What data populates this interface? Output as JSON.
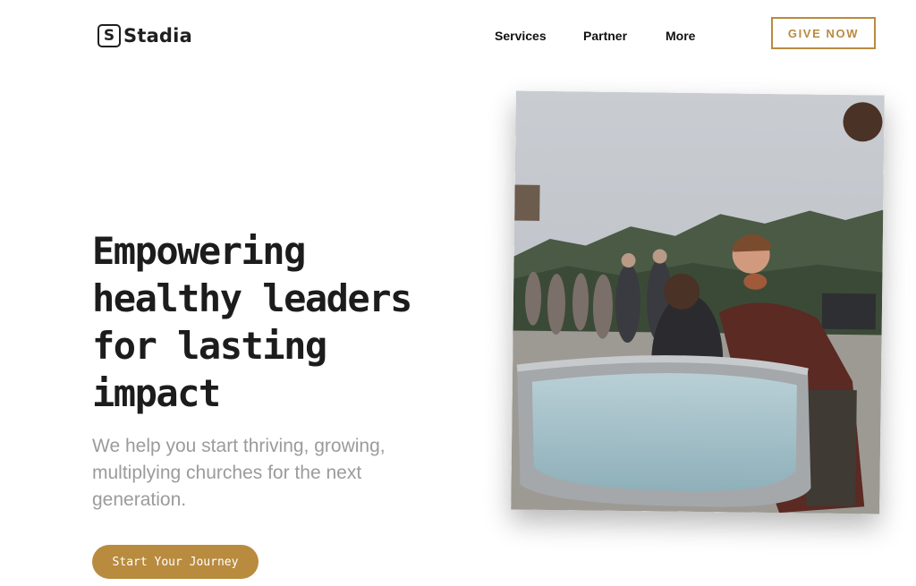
{
  "header": {
    "logo": {
      "mark": "S",
      "name": "Stadia"
    },
    "nav": [
      {
        "label": "Services"
      },
      {
        "label": "Partner"
      },
      {
        "label": "More"
      }
    ],
    "give_button": "GIVE NOW"
  },
  "hero": {
    "title": "Empowering healthy leaders for lasting impact",
    "subtitle": "We help you start thriving, growing, multiplying churches for the next generation.",
    "cta": "Start Your Journey",
    "image_icon": "baptism-photo"
  },
  "colors": {
    "accent": "#b98b3f",
    "text": "#1c1c1c",
    "muted": "#9b9b9b",
    "background": "#ffffff"
  }
}
